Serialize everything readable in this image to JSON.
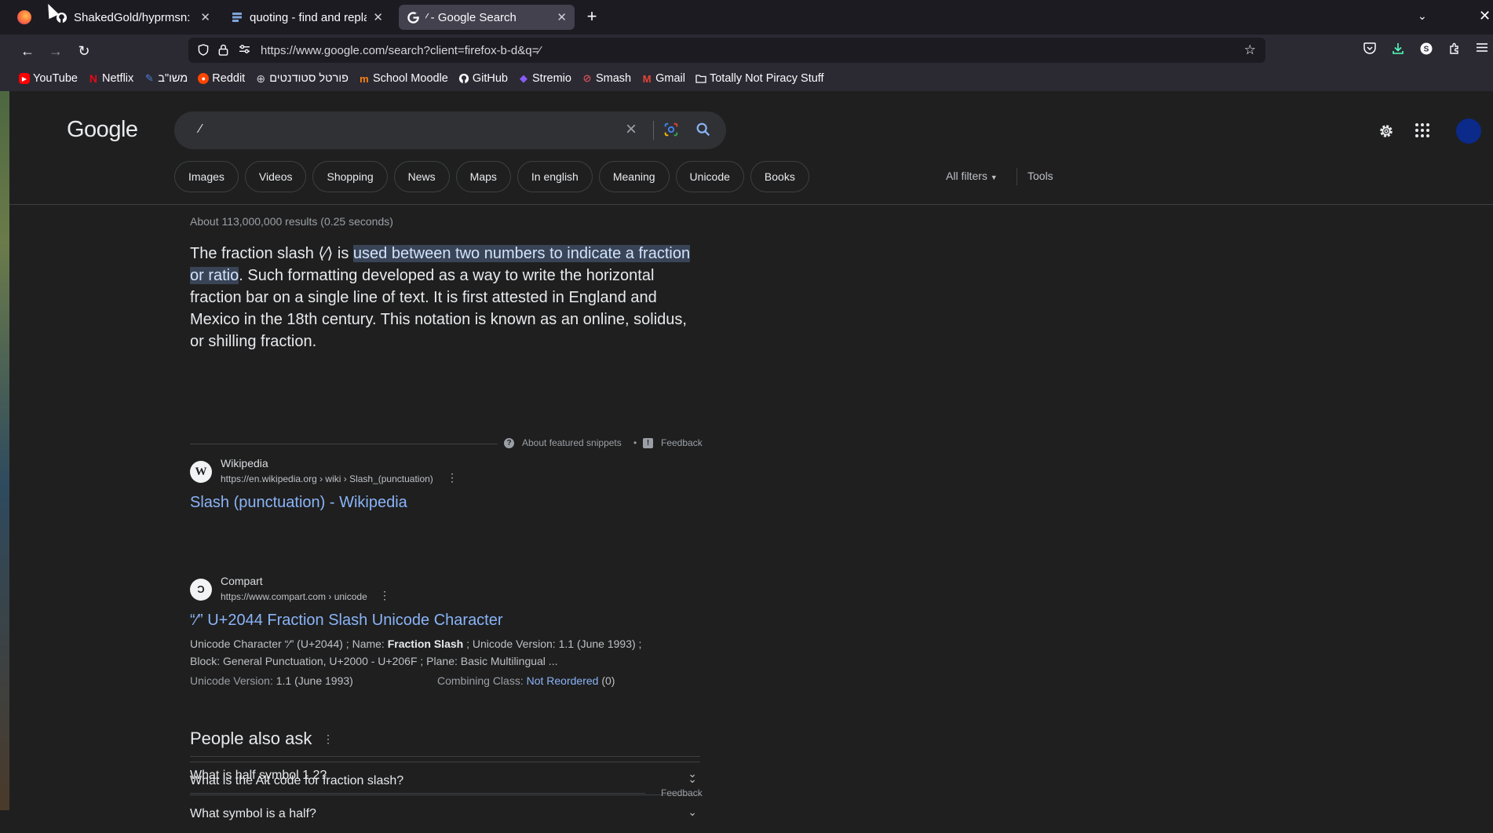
{
  "tabs": [
    {
      "title": "ShakedGold/hyprmsn: M",
      "icon": "github-icon",
      "active": false
    },
    {
      "title": "quoting - find and replace",
      "icon": "stackexchange-icon",
      "active": false
    },
    {
      "title": "⁄ - Google Search",
      "icon": "google-icon",
      "active": true
    }
  ],
  "urlbar": {
    "url": "https://www.google.com/search?client=firefox-b-d&q=⁄"
  },
  "bookmarks": [
    {
      "label": "YouTube",
      "icon": "youtube-icon",
      "color": "#ff0000"
    },
    {
      "label": "Netflix",
      "icon": "netflix-icon",
      "color": "#e50914"
    },
    {
      "label": "משו\"ב",
      "icon": "bird-icon",
      "color": "#4a7fd8"
    },
    {
      "label": "Reddit",
      "icon": "reddit-icon",
      "color": "#ff4500"
    },
    {
      "label": "פורטל סטודנטים",
      "icon": "globe-icon",
      "color": "#cfcfd8"
    },
    {
      "label": "School Moodle",
      "icon": "moodle-icon",
      "color": "#f98012"
    },
    {
      "label": "GitHub",
      "icon": "github-icon",
      "color": "#ffffff"
    },
    {
      "label": "Stremio",
      "icon": "stremio-icon",
      "color": "#8a5cf6"
    },
    {
      "label": "Smash",
      "icon": "smash-icon",
      "color": "#ff5a5f"
    },
    {
      "label": "Gmail",
      "icon": "gmail-icon",
      "color": "#ea4335"
    },
    {
      "label": "Totally Not Piracy Stuff",
      "icon": "folder-icon",
      "color": "#cfcfd8"
    }
  ],
  "google": {
    "logo": "Google",
    "query": "⁄",
    "chips": [
      "Images",
      "Videos",
      "Shopping",
      "News",
      "Maps",
      "In english",
      "Meaning",
      "Unicode",
      "Books"
    ],
    "all_filters": "All filters",
    "tools": "Tools"
  },
  "results": {
    "stats": "About 113,000,000 results (0.25 seconds)",
    "snippet": {
      "before": "The fraction slash ⟨⁄⟩ is ",
      "highlight": "used between two numbers to indicate a fraction or ratio",
      "after": ". Such formatting developed as a way to write the horizontal fraction bar on a single line of text. It is first attested in England and Mexico in the 18th century. This notation is known as an online, solidus, or shilling fraction."
    },
    "featured": {
      "site": "Wikipedia",
      "url": "https://en.wikipedia.org › wiki › Slash_(punctuation)",
      "title": "Slash (punctuation) - Wikipedia",
      "about": "About featured snippets",
      "feedback": "Feedback"
    },
    "compart": {
      "site": "Compart",
      "url": "https://www.compart.com › unicode",
      "title": "“⁄” U+2044 Fraction Slash Unicode Character",
      "desc1": "Unicode Character “⁄” (U+2044) ; Name: ",
      "desc_bold": "Fraction Slash",
      "desc2": " ; Unicode Version: 1.1 (June 1993) ;",
      "desc3": "Block: General Punctuation, U+2000 - U+206F ; Plane: Basic Multilingual ...",
      "meta1_label": "Unicode Version: ",
      "meta1_value": "1.1 (June 1993)",
      "meta2_label": "Combining Class: ",
      "meta2_link": "Not Reordered",
      "meta2_value": " (0)"
    }
  },
  "paa": {
    "title": "People also ask",
    "questions": [
      "What is half symbol 1 2?",
      "What symbol is a half?",
      "What is the Alt code for fraction slash?"
    ],
    "feedback": "Feedback"
  }
}
